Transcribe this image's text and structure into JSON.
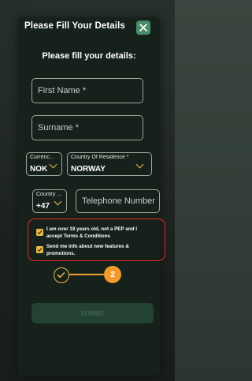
{
  "header": {
    "title": "Please Fill Your Details",
    "close_icon": "close-icon"
  },
  "subtitle": "Please fill your details:",
  "fields": {
    "first_name": {
      "placeholder": "First Name *"
    },
    "surname": {
      "placeholder": "Surname *"
    },
    "currency": {
      "label": "Currenc...",
      "value": "NOK"
    },
    "country_residence": {
      "label": "Country Of Residence *",
      "value": "NORWAY"
    },
    "country_code": {
      "label": "Country ...",
      "value": "+47"
    },
    "telephone": {
      "placeholder": "Telephone Number"
    }
  },
  "consents": [
    {
      "label": "I am over 18 years old, not a PEP and I accept Terms & Conditions",
      "checked": true
    },
    {
      "label": "Send me info about new features & promotions.",
      "checked": true
    }
  ],
  "steps": {
    "current": "2"
  },
  "submit_label": "SUBMIT",
  "colors": {
    "accent": "#e8b84a",
    "highlight": "#e02828",
    "step_badge": "#f29a2e"
  }
}
